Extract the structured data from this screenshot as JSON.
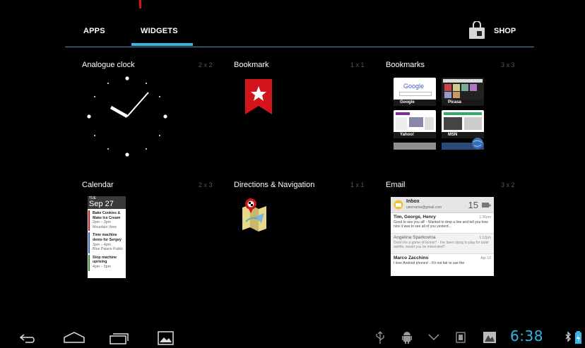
{
  "tabs": {
    "apps_label": "APPS",
    "widgets_label": "WIDGETS",
    "active": "WIDGETS",
    "shop_label": "SHOP"
  },
  "widgets": [
    {
      "title": "Analogue clock",
      "size": "2 x 2",
      "icon": "clock-icon"
    },
    {
      "title": "Bookmark",
      "size": "1 x 1",
      "icon": "bookmark-icon"
    },
    {
      "title": "Bookmarks",
      "size": "3 x 3",
      "icon": "bookmarks-grid"
    },
    {
      "title": "Calendar",
      "size": "2 x 3",
      "icon": "calendar-preview"
    },
    {
      "title": "Directions & Navigation",
      "size": "1 x 1",
      "icon": "map-icon"
    },
    {
      "title": "Email",
      "size": "3 x 2",
      "icon": "email-preview"
    }
  ],
  "bookmarks_preview": [
    {
      "caption": "Google",
      "page_text": "Google"
    },
    {
      "caption": "Picasa"
    },
    {
      "caption": "Yahoo!"
    },
    {
      "caption": "MSN"
    }
  ],
  "calendar_preview": {
    "day_of_week": "TUE",
    "date": "Sep 27",
    "events": [
      {
        "title": "Bake Cookies & Make Ice Cream",
        "time": "2pm – 3pm",
        "place": "Mountain View",
        "color": "#d3141c"
      },
      {
        "title": "Time machine demo for Sergey",
        "time": "3pm – 4pm",
        "place": "Blue Palace Public",
        "color": "#3b5fc0"
      },
      {
        "title": "Stop machine uprising",
        "time": "4pm – 5pm",
        "place": "",
        "color": "#2e8b2e"
      }
    ]
  },
  "email_preview": {
    "folder": "Inbox",
    "account": "username@gmail.com",
    "count": "15",
    "messages": [
      {
        "from": "Tim, George, Henry",
        "time": "1:36pm",
        "snippet": "Good to see you all! - Wanted to drop a line and tell you how nice it was to see all of you yesterd...",
        "unread": true
      },
      {
        "from": "Angelina Sparkovina",
        "time": "1:12pm",
        "snippet": "Down for a game of tennis? - I've been dying to play for quite awhile, would you be interested?",
        "unread": false
      },
      {
        "from": "Marco Zacchino",
        "time": "Apr 10",
        "snippet": "I love Android phones! - It's not fair to use the",
        "unread": true
      }
    ]
  },
  "status_bar": {
    "time": "6:38"
  },
  "colors": {
    "accent": "#33b5e5",
    "background": "#000000",
    "bookmark_red": "#d3141c"
  }
}
